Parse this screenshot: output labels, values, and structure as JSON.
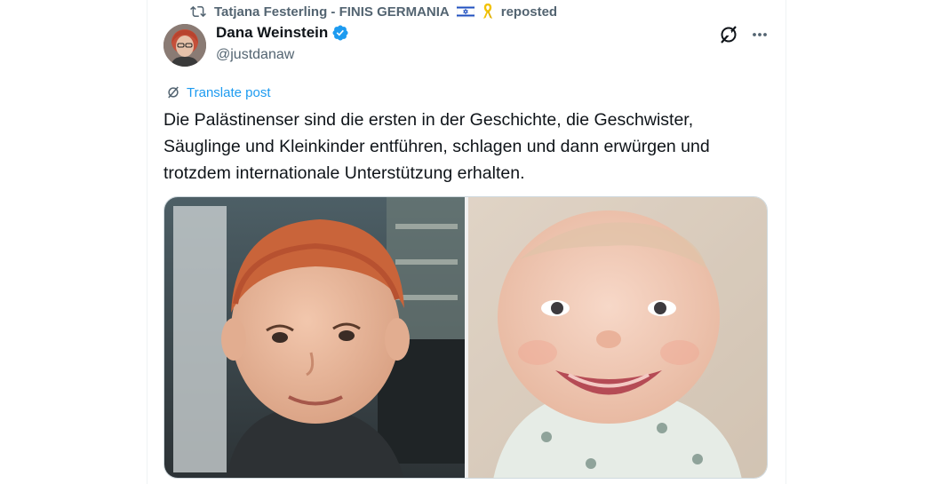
{
  "repost": {
    "reposter": "Tatjana Festerling - FINIS GERMANIA",
    "action": "reposted",
    "icon": "repost-icon"
  },
  "author": {
    "display_name": "Dana Weinstein",
    "handle": "@justdanaw",
    "verified": true,
    "verified_color": "#1d9bf0"
  },
  "translate": {
    "label": "Translate post"
  },
  "tweet": {
    "lines": [
      "Die Palästinenser sind die ersten in der Geschichte, die Geschwister,",
      "Säuglinge und Kleinkinder entführen, schlagen und dann erwürgen und",
      "trotzdem internationale Unterstützung erhalten."
    ]
  },
  "colors": {
    "accent": "#1d9bf0",
    "muted": "#536471",
    "text": "#0f1419"
  }
}
